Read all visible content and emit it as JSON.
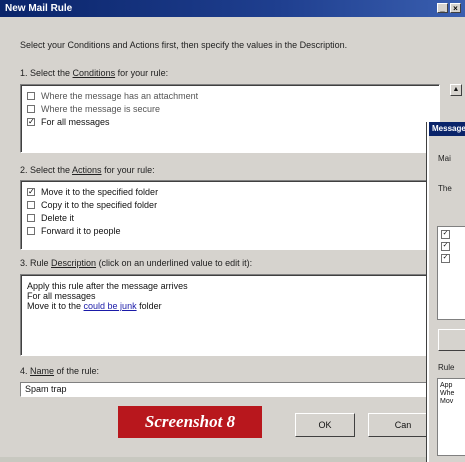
{
  "window": {
    "title": "New Mail Rule",
    "controls": [
      "minimize",
      "close"
    ]
  },
  "intro": "Select your Conditions and Actions first, then specify the values in the Description.",
  "conditions": {
    "label_prefix": "1. Select the ",
    "label_link": "Conditions",
    "label_suffix": " for your rule:",
    "items": [
      {
        "label": "Where the message has an attachment",
        "checked": false
      },
      {
        "label": "Where the message is secure",
        "checked": false
      },
      {
        "label": "For all messages",
        "checked": true
      }
    ]
  },
  "actions": {
    "label_prefix": "2. Select the ",
    "label_link": "Actions",
    "label_suffix": " for your rule:",
    "items": [
      {
        "label": "Move it to the specified folder",
        "checked": true
      },
      {
        "label": "Copy it to the specified folder",
        "checked": false
      },
      {
        "label": "Delete it",
        "checked": false
      },
      {
        "label": "Forward it to people",
        "checked": false
      }
    ]
  },
  "description": {
    "label_prefix": "3. Rule ",
    "label_link": "Description",
    "label_suffix": " (click on an underlined value to edit it):",
    "line1": "Apply this rule after the message arrives",
    "line2": "For all messages",
    "line3_prefix": "Move it to the ",
    "line3_link": "could be junk",
    "line3_suffix": " folder"
  },
  "name": {
    "label_prefix": "4. ",
    "label_link": "Name",
    "label_suffix": " of the rule:",
    "value": "Spam trap"
  },
  "buttons": {
    "ok": "OK",
    "cancel": "Can"
  },
  "badge": "Screenshot 8",
  "second_window": {
    "title": "Message",
    "line1": "Mai",
    "line2": "The",
    "desc_lines": [
      "App",
      "Whe",
      "Mov"
    ],
    "rule_label": "Rule"
  },
  "colors": {
    "titlebar": "#0a246a",
    "window_bg": "#d6d3ce",
    "badge": "#b8171d",
    "link": "#1a1aa8"
  }
}
